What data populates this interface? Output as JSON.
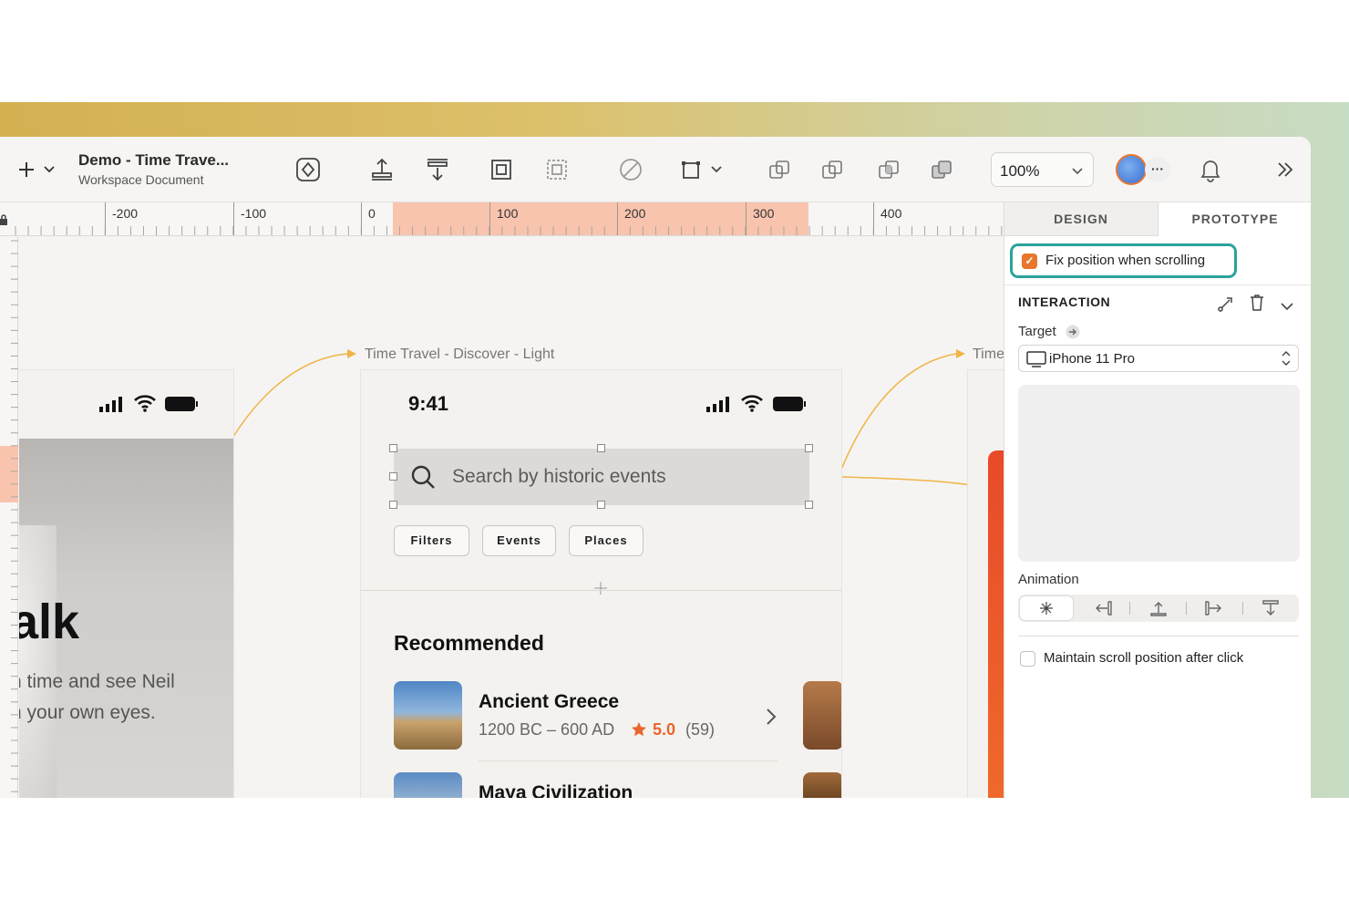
{
  "app": {
    "doc_title": "Demo - Time Trave...",
    "doc_subtitle": "Workspace Document"
  },
  "toolbar": {
    "add_icon": "plus-icon",
    "zoom_value": "100%"
  },
  "ruler": {
    "labels": [
      "-200",
      "-100",
      "0",
      "100",
      "200",
      "300",
      "400"
    ]
  },
  "canvas": {
    "left_frame": {
      "headline_fragment": "alk",
      "body_line_1": "n time and see Neil",
      "body_line_2": "h your own eyes."
    },
    "frame_label": "Time Travel - Discover - Light",
    "frame_label_right": "Time",
    "phone": {
      "time": "9:41",
      "search_placeholder": "Search by historic events",
      "chips": [
        "Filters",
        "Events",
        "Places"
      ],
      "recommended_title": "Recommended",
      "items": [
        {
          "name": "Ancient Greece",
          "period": "1200 BC – 600 AD",
          "rating": "5.0",
          "count": "(59)"
        },
        {
          "name": "Maya Civilization"
        }
      ]
    }
  },
  "panel": {
    "tabs": [
      "DESIGN",
      "PROTOTYPE"
    ],
    "fix_position_label": "Fix position when scrolling",
    "fix_position_checked": true,
    "interaction_header": "INTERACTION",
    "target_label": "Target",
    "target_value": "iPhone 11 Pro",
    "animation_label": "Animation",
    "maintain_scroll_label": "Maintain scroll position after click",
    "accent_color": "#e8762c",
    "focus_color": "#2aa39c"
  }
}
